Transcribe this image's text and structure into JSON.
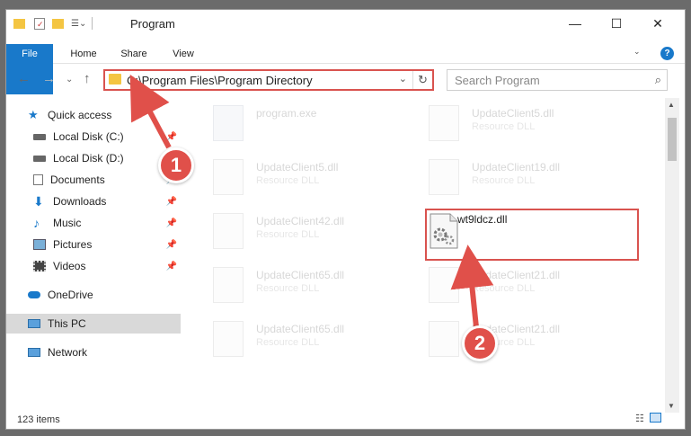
{
  "window": {
    "title": "Program",
    "minimize_glyph": "—",
    "maximize_glyph": "☐",
    "close_glyph": "✕"
  },
  "ribbon": {
    "tabs": [
      "File",
      "Home",
      "Share",
      "View"
    ],
    "help_glyph": "?"
  },
  "address_bar": {
    "path": "C:\\Program Files\\Program Directory",
    "refresh_glyph": "↻",
    "dropdown_glyph": "⌄"
  },
  "search": {
    "placeholder": "Search Program",
    "icon_glyph": "⌕"
  },
  "nav": {
    "back_glyph": "←",
    "forward_glyph": "→",
    "recent_glyph": "⌄",
    "up_glyph": "↑"
  },
  "sidebar": {
    "items": [
      {
        "label": "Quick access",
        "icon": "star-icon",
        "pinned": false
      },
      {
        "label": "Local Disk (C:)",
        "icon": "drive-icon",
        "pinned": true
      },
      {
        "label": "Local Disk (D:)",
        "icon": "drive-icon",
        "pinned": false
      },
      {
        "label": "Documents",
        "icon": "documents-icon",
        "pinned": true
      },
      {
        "label": "Downloads",
        "icon": "download-icon",
        "pinned": true
      },
      {
        "label": "Music",
        "icon": "music-icon",
        "pinned": true
      },
      {
        "label": "Pictures",
        "icon": "pictures-icon",
        "pinned": true
      },
      {
        "label": "Videos",
        "icon": "videos-icon",
        "pinned": true
      },
      {
        "label": "OneDrive",
        "icon": "cloud-icon",
        "pinned": false
      },
      {
        "label": "This PC",
        "icon": "computer-icon",
        "pinned": false,
        "selected": true
      },
      {
        "label": "Network",
        "icon": "network-icon",
        "pinned": false
      }
    ],
    "pin_glyph": "📌"
  },
  "files": [
    {
      "name": "program.exe",
      "type": "",
      "faded": true
    },
    {
      "name": "UpdateClient5.dll",
      "type": "Resource DLL",
      "faded": true
    },
    {
      "name": "UpdateClient5.dll",
      "type": "Resource DLL",
      "faded": true
    },
    {
      "name": "UpdateClient19.dll",
      "type": "Resource DLL",
      "faded": true
    },
    {
      "name": "UpdateClient42.dll",
      "type": "Resource DLL",
      "faded": true
    },
    {
      "name": "wt9ldcz.dll",
      "type": "",
      "faded": false
    },
    {
      "name": "UpdateClient65.dll",
      "type": "Resource DLL",
      "faded": true
    },
    {
      "name": "UpdateClient21.dll",
      "type": "Resource DLL",
      "faded": true
    },
    {
      "name": "UpdateClient65.dll",
      "type": "Resource DLL",
      "faded": true
    },
    {
      "name": "UpdateClient21.dll",
      "type": "Resource DLL",
      "faded": true
    }
  ],
  "status": {
    "item_count": "123 items"
  },
  "annotations": {
    "step1": "1",
    "step2": "2",
    "color": "#e0504a"
  }
}
